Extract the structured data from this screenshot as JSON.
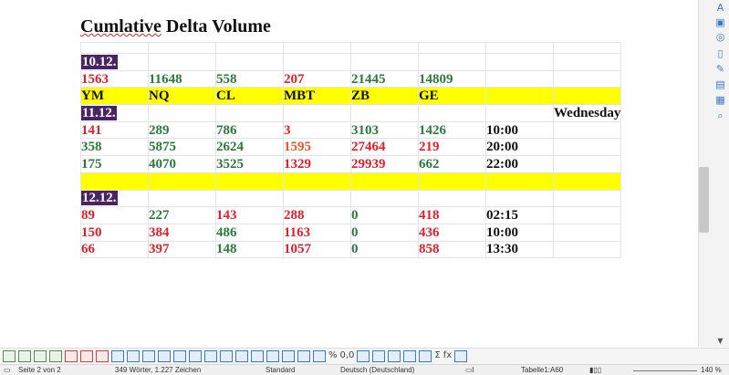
{
  "document": {
    "title_misspelled": "Cumlative",
    "title_rest": " Delta Volume"
  },
  "table": {
    "rows": [
      {
        "type": "date",
        "cells": [
          "10.12.",
          "",
          "",
          "",
          "",
          "",
          "",
          ""
        ]
      },
      {
        "type": "data",
        "cells": [
          "1563",
          "11648",
          "558",
          "207",
          "21445",
          "14809",
          "",
          ""
        ],
        "colors": [
          "r",
          "g",
          "g",
          "r",
          "g",
          "g",
          "k",
          "k"
        ]
      },
      {
        "type": "header",
        "cells": [
          "YM",
          "NQ",
          "CL",
          "MBT",
          "ZB",
          "GE",
          "",
          ""
        ]
      },
      {
        "type": "date",
        "cells": [
          "11.12.",
          "",
          "",
          "",
          "",
          "",
          "",
          "Wednesday"
        ]
      },
      {
        "type": "data",
        "cells": [
          "141",
          "289",
          "786",
          "3",
          "3103",
          "1426",
          "10:00",
          ""
        ],
        "colors": [
          "r",
          "g",
          "g",
          "r",
          "g",
          "g",
          "k",
          "k"
        ]
      },
      {
        "type": "data",
        "cells": [
          "358",
          "5875",
          "2624",
          "1595",
          "27464",
          "219",
          "20:00",
          ""
        ],
        "colors": [
          "g",
          "g",
          "g",
          "o",
          "r",
          "r",
          "k",
          "k"
        ]
      },
      {
        "type": "data",
        "cells": [
          "175",
          "4070",
          "3525",
          "1329",
          "29939",
          "662",
          "22:00",
          ""
        ],
        "colors": [
          "g",
          "g",
          "g",
          "r",
          "r",
          "g",
          "k",
          "k"
        ]
      },
      {
        "type": "header",
        "cells": [
          "",
          "",
          "",
          "",
          "",
          "",
          "",
          ""
        ]
      },
      {
        "type": "date",
        "cells": [
          "12.12.",
          "",
          "",
          "",
          "",
          "",
          "",
          ""
        ]
      },
      {
        "type": "data",
        "cells": [
          "89",
          "227",
          "143",
          "288",
          "0",
          "418",
          "02:15",
          ""
        ],
        "colors": [
          "r",
          "g",
          "r",
          "r",
          "g",
          "r",
          "k",
          "k"
        ]
      },
      {
        "type": "data",
        "cells": [
          "150",
          "384",
          "486",
          "1163",
          "0",
          "436",
          "10:00",
          ""
        ],
        "colors": [
          "r",
          "r",
          "g",
          "r",
          "g",
          "r",
          "k",
          "k"
        ]
      },
      {
        "type": "data",
        "cells": [
          "66",
          "397",
          "148",
          "1057",
          "0",
          "858",
          "13:30",
          ""
        ],
        "colors": [
          "r",
          "r",
          "g",
          "r",
          "g",
          "r",
          "k",
          "k"
        ]
      }
    ]
  },
  "statusbar": {
    "page": "Seite 2 von 2",
    "words": "349 Wörter, 1.227 Zeichen",
    "style": "Standard",
    "language": "Deutsch (Deutschland)",
    "cell": "Tabelle1:A60",
    "zoom": "140 %"
  },
  "toolbar": {
    "icons": [
      "insert-rows-above",
      "insert-rows-below",
      "insert-columns-before",
      "insert-columns-after",
      "delete-rows",
      "delete-columns",
      "delete-table",
      "select-table",
      "select-cell",
      "merge-cells",
      "split-cells",
      "split-table",
      "optimize",
      "align-top",
      "center-vertically",
      "align-bottom",
      "background-color",
      "borders",
      "border-style",
      "border-color",
      "number-format",
      "percent",
      "decimal",
      "table-properties",
      "autoformat",
      "sort",
      "protect-cells",
      "unprotect-cells",
      "sum",
      "formula",
      "table-props"
    ],
    "symbols": {
      "percent": "%",
      "decimal": "0,0",
      "sum": "Σ",
      "formula": "fx"
    }
  },
  "colors": {
    "red": "#e0202a",
    "green": "#2b7a3b",
    "orange": "#e9572b",
    "purple": "#4a2462",
    "yellow": "#ffff00"
  }
}
